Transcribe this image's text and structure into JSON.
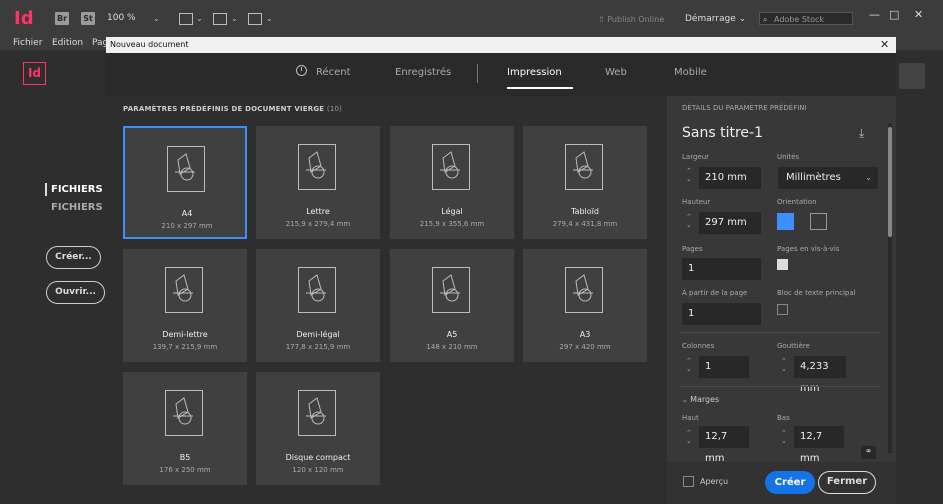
{
  "app": {
    "logo": "Id",
    "bridge": "Br",
    "stock_app": "St",
    "zoom": "100 %",
    "publish": "Publish Online",
    "workspace": "Démarrage",
    "search_placeholder": "Adobe Stock"
  },
  "menu": [
    "Fichier",
    "Edition",
    "Pag"
  ],
  "background": {
    "logo": "Id",
    "recent_files": "FICHIERS RI",
    "files_cc": "FICHIERS C",
    "create_btn": "Créer...",
    "open_btn": "Ouvrir..."
  },
  "dialog": {
    "title": "Nouveau document",
    "tabs": [
      "Récent",
      "Enregistrés",
      "Impression",
      "Web",
      "Mobile"
    ],
    "active_tab": "Impression",
    "section_title": "PARAMÈTRES PRÉDÉFINIS DE DOCUMENT VIERGE",
    "section_count": "(10)",
    "presets": [
      {
        "name": "A4",
        "size": "210 x 297 mm",
        "selected": true
      },
      {
        "name": "Lettre",
        "size": "215,9 x 279,4 mm"
      },
      {
        "name": "Légal",
        "size": "215,9 x 355,6 mm"
      },
      {
        "name": "Tabloïd",
        "size": "279,4 x 431,8 mm"
      },
      {
        "name": "Demi-lettre",
        "size": "139,7 x 215,9 mm"
      },
      {
        "name": "Demi-légal",
        "size": "177,8 x 215,9 mm"
      },
      {
        "name": "A5",
        "size": "148 x 210 mm"
      },
      {
        "name": "A3",
        "size": "297 x 420 mm"
      },
      {
        "name": "B5",
        "size": "176 x 250 mm"
      },
      {
        "name": "Disque compact",
        "size": "120 x 120 mm"
      }
    ],
    "details": {
      "header": "DÉTAILS DU PARAMÈTRE PRÉDÉFINI",
      "doc_name": "Sans titre-1",
      "width_label": "Largeur",
      "width": "210 mm",
      "units_label": "Unités",
      "units": "Millimètres",
      "height_label": "Hauteur",
      "height": "297 mm",
      "orientation_label": "Orientation",
      "pages_label": "Pages",
      "pages": "1",
      "facing_label": "Pages en vis-à-vis",
      "start_label": "À partir de la page",
      "start": "1",
      "primary_text_label": "Bloc de texte principal",
      "columns_label": "Colonnes",
      "columns": "1",
      "gutter_label": "Gouttière",
      "gutter": "4,233 mm",
      "margins_label": "Marges",
      "top_label": "Haut",
      "top": "12,7 mm",
      "bottom_label": "Bas",
      "bottom": "12,7 mm"
    },
    "preview_label": "Aperçu",
    "create_label": "Créer",
    "close_label": "Fermer"
  }
}
